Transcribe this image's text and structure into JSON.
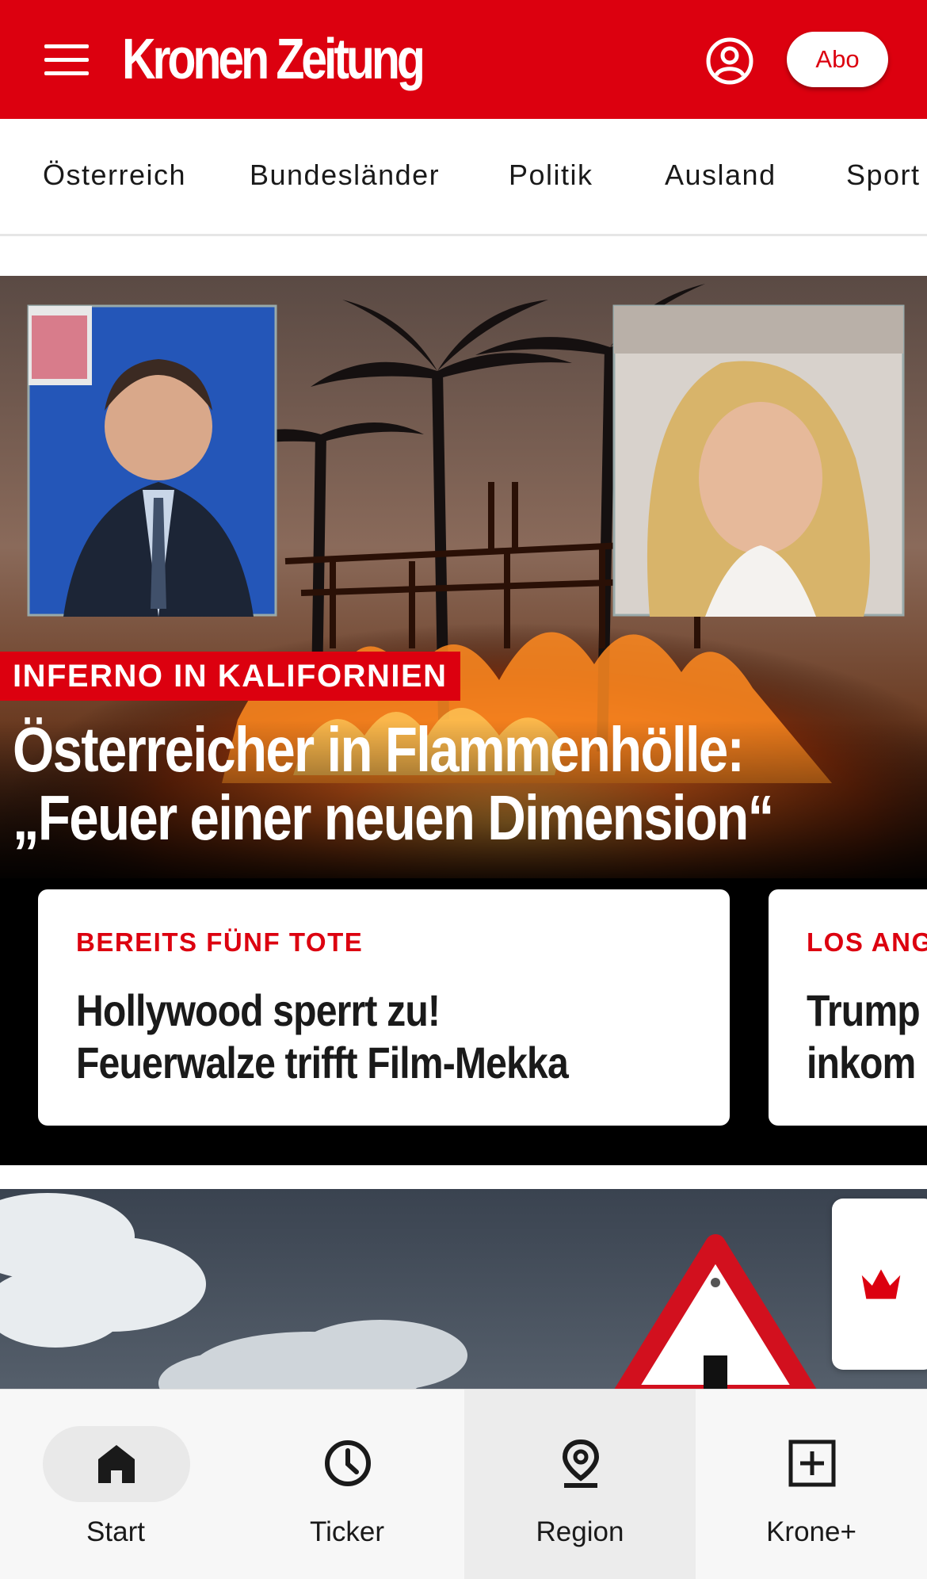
{
  "header": {
    "logo": "Kronen Zeitung",
    "abo_label": "Abo",
    "brand_color": "#dc000f"
  },
  "nav": {
    "items": [
      {
        "label": "Österreich"
      },
      {
        "label": "Bundesländer"
      },
      {
        "label": "Politik"
      },
      {
        "label": "Ausland"
      },
      {
        "label": "Sport"
      }
    ]
  },
  "hero": {
    "kicker": "INFERNO IN KALIFORNIEN",
    "headline_line1": "Österreicher in Flammenhölle:",
    "headline_line2": "„Feuer einer neuen Dimension“",
    "cards": [
      {
        "kicker": "BEREITS FÜNF TOTE",
        "title_line1": "Hollywood sperrt zu!",
        "title_line2": "Feuerwalze trifft Film-Mekka"
      },
      {
        "kicker": "LOS ANG",
        "title_line1": "Trump",
        "title_line2": "inkom"
      }
    ]
  },
  "bottom_nav": {
    "items": [
      {
        "label": "Start",
        "icon": "home-icon"
      },
      {
        "label": "Ticker",
        "icon": "clock-icon"
      },
      {
        "label": "Region",
        "icon": "location-pin-icon"
      },
      {
        "label": "Krone+",
        "icon": "plus-box-icon"
      }
    ]
  }
}
